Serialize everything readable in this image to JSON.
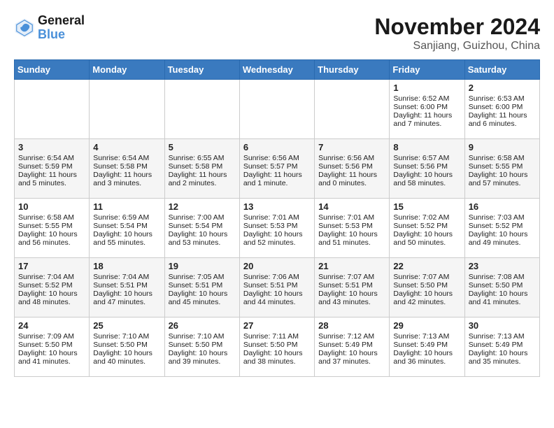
{
  "header": {
    "logo_line1": "General",
    "logo_line2": "Blue",
    "month_title": "November 2024",
    "location": "Sanjiang, Guizhou, China"
  },
  "weekdays": [
    "Sunday",
    "Monday",
    "Tuesday",
    "Wednesday",
    "Thursday",
    "Friday",
    "Saturday"
  ],
  "weeks": [
    [
      {
        "day": "",
        "info": ""
      },
      {
        "day": "",
        "info": ""
      },
      {
        "day": "",
        "info": ""
      },
      {
        "day": "",
        "info": ""
      },
      {
        "day": "",
        "info": ""
      },
      {
        "day": "1",
        "info": "Sunrise: 6:52 AM\nSunset: 6:00 PM\nDaylight: 11 hours and 7 minutes."
      },
      {
        "day": "2",
        "info": "Sunrise: 6:53 AM\nSunset: 6:00 PM\nDaylight: 11 hours and 6 minutes."
      }
    ],
    [
      {
        "day": "3",
        "info": "Sunrise: 6:54 AM\nSunset: 5:59 PM\nDaylight: 11 hours and 5 minutes."
      },
      {
        "day": "4",
        "info": "Sunrise: 6:54 AM\nSunset: 5:58 PM\nDaylight: 11 hours and 3 minutes."
      },
      {
        "day": "5",
        "info": "Sunrise: 6:55 AM\nSunset: 5:58 PM\nDaylight: 11 hours and 2 minutes."
      },
      {
        "day": "6",
        "info": "Sunrise: 6:56 AM\nSunset: 5:57 PM\nDaylight: 11 hours and 1 minute."
      },
      {
        "day": "7",
        "info": "Sunrise: 6:56 AM\nSunset: 5:56 PM\nDaylight: 11 hours and 0 minutes."
      },
      {
        "day": "8",
        "info": "Sunrise: 6:57 AM\nSunset: 5:56 PM\nDaylight: 10 hours and 58 minutes."
      },
      {
        "day": "9",
        "info": "Sunrise: 6:58 AM\nSunset: 5:55 PM\nDaylight: 10 hours and 57 minutes."
      }
    ],
    [
      {
        "day": "10",
        "info": "Sunrise: 6:58 AM\nSunset: 5:55 PM\nDaylight: 10 hours and 56 minutes."
      },
      {
        "day": "11",
        "info": "Sunrise: 6:59 AM\nSunset: 5:54 PM\nDaylight: 10 hours and 55 minutes."
      },
      {
        "day": "12",
        "info": "Sunrise: 7:00 AM\nSunset: 5:54 PM\nDaylight: 10 hours and 53 minutes."
      },
      {
        "day": "13",
        "info": "Sunrise: 7:01 AM\nSunset: 5:53 PM\nDaylight: 10 hours and 52 minutes."
      },
      {
        "day": "14",
        "info": "Sunrise: 7:01 AM\nSunset: 5:53 PM\nDaylight: 10 hours and 51 minutes."
      },
      {
        "day": "15",
        "info": "Sunrise: 7:02 AM\nSunset: 5:52 PM\nDaylight: 10 hours and 50 minutes."
      },
      {
        "day": "16",
        "info": "Sunrise: 7:03 AM\nSunset: 5:52 PM\nDaylight: 10 hours and 49 minutes."
      }
    ],
    [
      {
        "day": "17",
        "info": "Sunrise: 7:04 AM\nSunset: 5:52 PM\nDaylight: 10 hours and 48 minutes."
      },
      {
        "day": "18",
        "info": "Sunrise: 7:04 AM\nSunset: 5:51 PM\nDaylight: 10 hours and 47 minutes."
      },
      {
        "day": "19",
        "info": "Sunrise: 7:05 AM\nSunset: 5:51 PM\nDaylight: 10 hours and 45 minutes."
      },
      {
        "day": "20",
        "info": "Sunrise: 7:06 AM\nSunset: 5:51 PM\nDaylight: 10 hours and 44 minutes."
      },
      {
        "day": "21",
        "info": "Sunrise: 7:07 AM\nSunset: 5:51 PM\nDaylight: 10 hours and 43 minutes."
      },
      {
        "day": "22",
        "info": "Sunrise: 7:07 AM\nSunset: 5:50 PM\nDaylight: 10 hours and 42 minutes."
      },
      {
        "day": "23",
        "info": "Sunrise: 7:08 AM\nSunset: 5:50 PM\nDaylight: 10 hours and 41 minutes."
      }
    ],
    [
      {
        "day": "24",
        "info": "Sunrise: 7:09 AM\nSunset: 5:50 PM\nDaylight: 10 hours and 41 minutes."
      },
      {
        "day": "25",
        "info": "Sunrise: 7:10 AM\nSunset: 5:50 PM\nDaylight: 10 hours and 40 minutes."
      },
      {
        "day": "26",
        "info": "Sunrise: 7:10 AM\nSunset: 5:50 PM\nDaylight: 10 hours and 39 minutes."
      },
      {
        "day": "27",
        "info": "Sunrise: 7:11 AM\nSunset: 5:50 PM\nDaylight: 10 hours and 38 minutes."
      },
      {
        "day": "28",
        "info": "Sunrise: 7:12 AM\nSunset: 5:49 PM\nDaylight: 10 hours and 37 minutes."
      },
      {
        "day": "29",
        "info": "Sunrise: 7:13 AM\nSunset: 5:49 PM\nDaylight: 10 hours and 36 minutes."
      },
      {
        "day": "30",
        "info": "Sunrise: 7:13 AM\nSunset: 5:49 PM\nDaylight: 10 hours and 35 minutes."
      }
    ]
  ]
}
